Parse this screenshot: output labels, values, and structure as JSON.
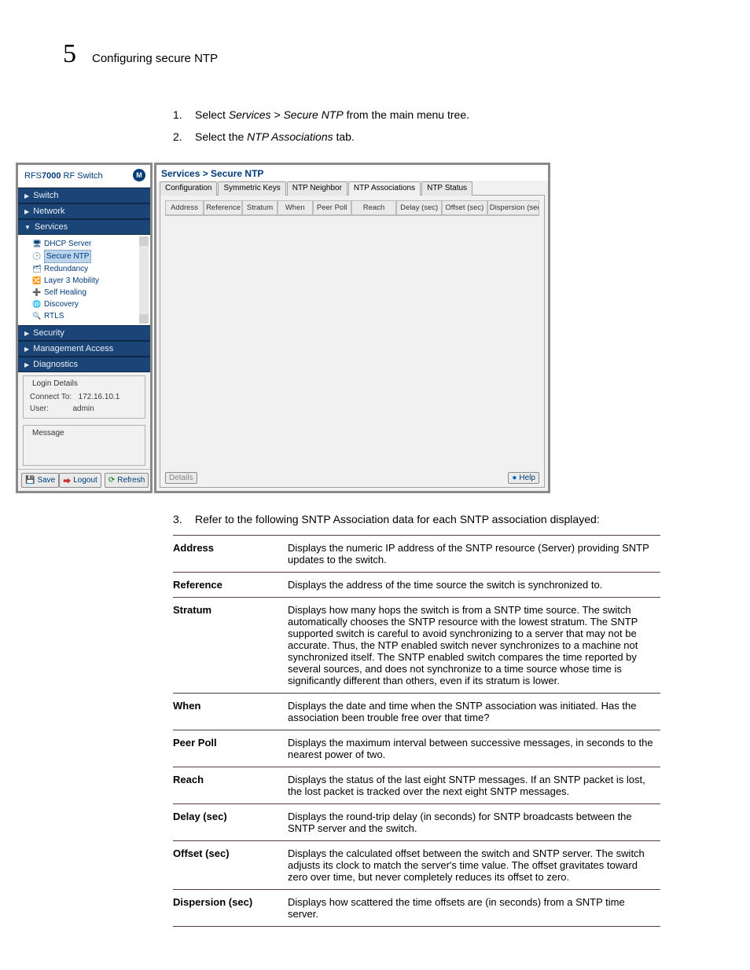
{
  "page": {
    "chapter_num": "5",
    "chapter_title": "Configuring secure NTP",
    "step1_n": "1.",
    "step1_pre": "Select ",
    "step1_path": "Services > Secure NTP",
    "step1_post": " from the main menu tree.",
    "step2_n": "2.",
    "step2_pre": "Select the ",
    "step2_tab": "NTP Associations",
    "step2_post": " tab.",
    "step3_n": "3.",
    "step3_text": "Refer to the following SNTP Association data for each SNTP association displayed:"
  },
  "screenshot": {
    "brand_prefix": "RFS",
    "brand_bold": "7000",
    "brand_suffix": " RF Switch",
    "logo_letter": "M",
    "nav": {
      "switch": "Switch",
      "network": "Network",
      "services": "Services",
      "security": "Security",
      "management_access": "Management Access",
      "diagnostics": "Diagnostics"
    },
    "tree": {
      "dhcp": "DHCP Server",
      "secure_ntp": "Secure NTP",
      "redundancy": "Redundancy",
      "l3mobility": "Layer 3 Mobility",
      "self_healing": "Self Healing",
      "discovery": "Discovery",
      "rtls": "RTLS"
    },
    "login_details": {
      "legend": "Login Details",
      "connect_label": "Connect To:",
      "connect_value": "172.16.10.1",
      "user_label": "User:",
      "user_value": "admin"
    },
    "message_legend": "Message",
    "buttons": {
      "save": "Save",
      "logout": "Logout",
      "refresh": "Refresh",
      "details": "Details",
      "help": "Help"
    },
    "breadcrumb": "Services > Secure NTP",
    "tabs": {
      "configuration": "Configuration",
      "symkeys": "Symmetric Keys",
      "ntp_neighbor": "NTP Neighbor",
      "ntp_assoc": "NTP Associations",
      "ntp_status": "NTP Status"
    },
    "columns": {
      "address": "Address",
      "reference": "Reference",
      "stratum": "Stratum",
      "when": "When",
      "peer_poll": "Peer Poll",
      "reach": "Reach",
      "delay": "Delay (sec)",
      "offset": "Offset (sec)",
      "dispersion": "Dispersion (sec)"
    }
  },
  "descriptions": [
    {
      "k": "Address",
      "v": "Displays the numeric IP address of the SNTP resource (Server) providing SNTP updates to the switch."
    },
    {
      "k": "Reference",
      "v": "Displays the address of the time source the switch is synchronized to."
    },
    {
      "k": "Stratum",
      "v": "Displays how many hops the switch is from a SNTP time source. The switch automatically chooses the SNTP resource with the lowest stratum. The SNTP supported switch is careful to avoid synchronizing to a server that may not be accurate. Thus, the NTP enabled switch never synchronizes to a machine not synchronized itself. The SNTP enabled switch compares the time reported by several sources, and does not synchronize to a time source whose time is significantly different than others, even if its stratum is lower."
    },
    {
      "k": "When",
      "v": "Displays the date and time when the SNTP association was initiated. Has the association been trouble free over that time?"
    },
    {
      "k": "Peer Poll",
      "v": "Displays the maximum interval between successive messages, in seconds to the nearest power of two."
    },
    {
      "k": "Reach",
      "v": "Displays the status of the last eight SNTP messages. If an SNTP packet is lost, the lost packet is tracked over the next eight SNTP messages."
    },
    {
      "k": "Delay (sec)",
      "v": "Displays the round-trip delay (in seconds) for SNTP broadcasts between the SNTP server and the switch."
    },
    {
      "k": "Offset (sec)",
      "v": "Displays the calculated offset between the switch and SNTP server. The switch adjusts its clock to match the server's time value. The offset gravitates toward zero over time, but never completely reduces its offset to zero."
    },
    {
      "k": "Dispersion (sec)",
      "v": "Displays how scattered the time offsets are (in seconds) from a SNTP time server."
    }
  ]
}
